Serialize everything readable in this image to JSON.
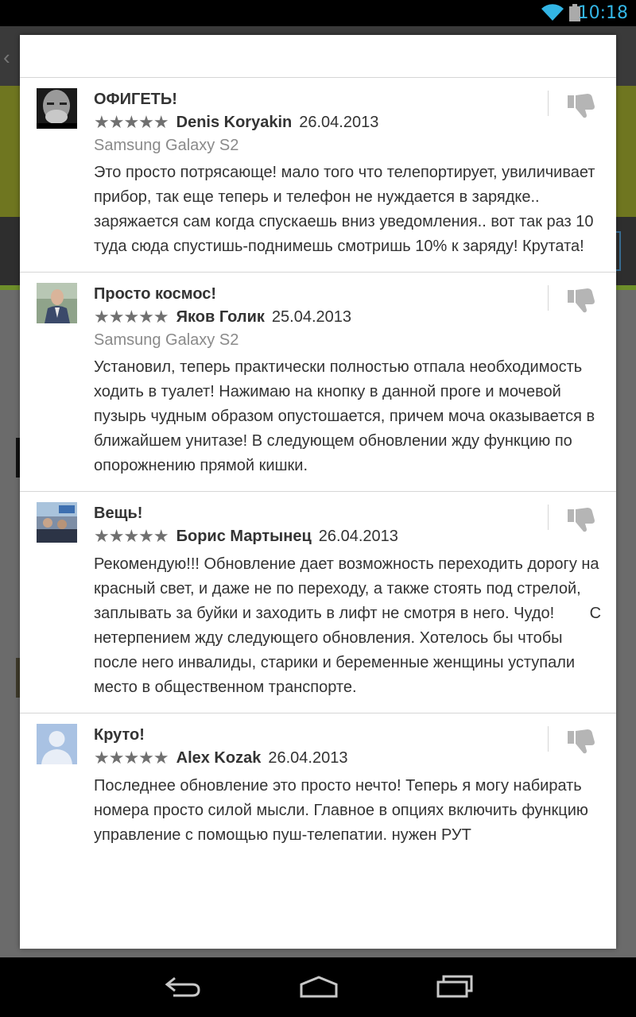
{
  "status_bar": {
    "time": "10:18"
  },
  "reviews": [
    {
      "title": "ОФИГЕТЬ!",
      "stars": "★★★★★",
      "rating": 5,
      "author": "Denis Koryakin",
      "date": "26.04.2013",
      "device": "Samsung Galaxy S2",
      "text": "Это просто потрясающе! мало того что телепортирует, увиличивает прибор, так еще теперь и телефон не нуждается в зарядке.. заряжается сам когда спускаешь вниз уведомления.. вот так раз 10 туда сюда спустишь-поднимешь смотришь 10% к заряду! Крутата!"
    },
    {
      "title": "Просто космос!",
      "stars": "★★★★★",
      "rating": 5,
      "author": "Яков Голик",
      "date": "25.04.2013",
      "device": "Samsung Galaxy S2",
      "text": "Установил, теперь практически полностью отпала необходимость ходить в туалет! Нажимаю на кнопку в данной проге и мочевой пузырь чудным образом опустошается, причем моча оказывается в ближайшем унитазе! В следующем обновлении жду функцию по опорожнению прямой кишки."
    },
    {
      "title": "Вещь!",
      "stars": "★★★★★",
      "rating": 5,
      "author": "Борис Мартынец",
      "date": "26.04.2013",
      "device": "",
      "text": "Рекомендую!!! Обновление дает возможность переходить дорогу на красный свет, и даже не по переходу, а также стоять под стрелой, заплывать за буйки и заходить в лифт не смотря в него. Чудо!        С нетерпением жду следующего обновления. Хотелось бы чтобы после него инвалиды, старики и беременные женщины уступали место в общественном транспорте."
    },
    {
      "title": "Круто!",
      "stars": "★★★★★",
      "rating": 5,
      "author": "Alex Kozak",
      "date": "26.04.2013",
      "device": "",
      "text": "Последнее обновление это просто нечто! Теперь я могу набирать номера просто силой мысли. Главное в опциях включить функцию управление с помощью пуш-телепатии. нужен РУТ"
    }
  ],
  "colors": {
    "accent": "#33b5e5",
    "star": "#707070",
    "text": "#333333",
    "secondary_text": "#8a8a8a"
  }
}
